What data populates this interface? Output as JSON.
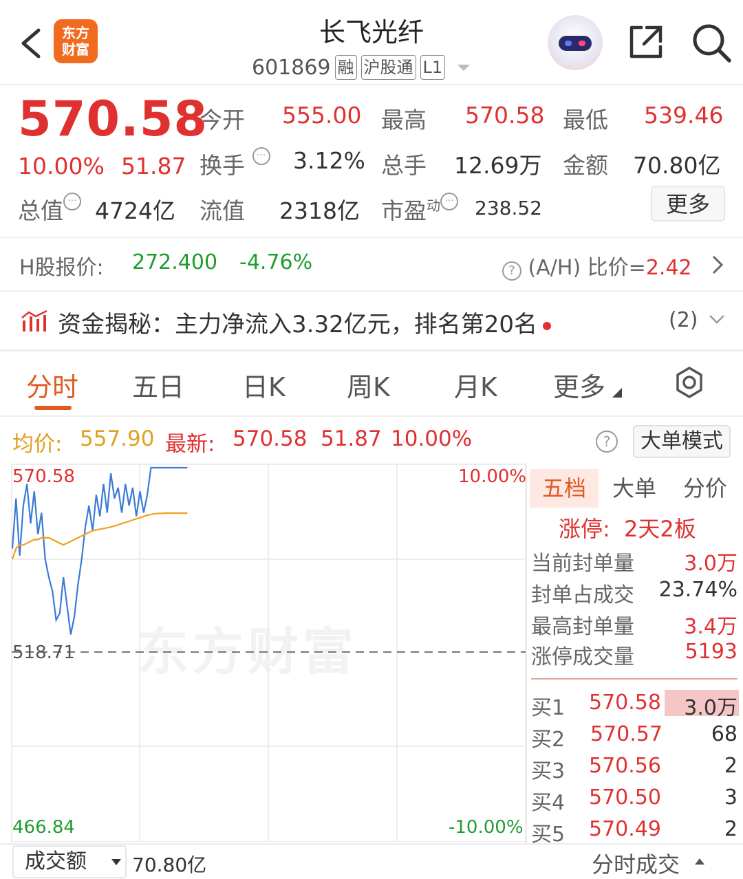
{
  "header": {
    "logo_text": "东方\n财富",
    "stock_name": "长飞光纤",
    "stock_code": "601869",
    "tags": [
      "融",
      "沪股通",
      "L1"
    ]
  },
  "quote": {
    "price": "570.58",
    "change_pct": "10.00%",
    "change_amt": "51.87",
    "fields": {
      "open_label": "今开",
      "open_value": "555.00",
      "high_label": "最高",
      "high_value": "570.58",
      "low_label": "最低",
      "low_value": "539.46",
      "turnover_label": "换手",
      "turnover_value": "3.12%",
      "volume_label": "总手",
      "volume_value": "12.69万",
      "amount_label": "金额",
      "amount_value": "70.80亿",
      "mktcap_label": "总值",
      "mktcap_value": "4724亿",
      "float_label": "流值",
      "float_value": "2318亿",
      "pe_label": "市盈",
      "pe_sup": "动",
      "pe_value": "238.52"
    },
    "more_button": "更多"
  },
  "h_share": {
    "label": "H股报价:",
    "price": "272.400",
    "change": "-4.76%",
    "ah_label": "(A/H) 比价=",
    "ah_value": "2.42"
  },
  "fund_flow": {
    "text": "资金揭秘：主力净流入3.32亿元，排名第20名",
    "count": "(2)"
  },
  "tabs": [
    "分时",
    "五日",
    "日K",
    "周K",
    "月K",
    "更多"
  ],
  "active_tab": "分时",
  "chart_header": {
    "avg_label": "均价:",
    "avg_value": "557.90",
    "latest_label": "最新:",
    "latest_price": "570.58",
    "latest_change": "51.87",
    "latest_pct": "10.00%",
    "big_order_button": "大单模式"
  },
  "chart_data": {
    "type": "line",
    "y_max_label": "570.58",
    "y_mid_label": "518.71",
    "y_min_label": "466.84",
    "pct_max_label": "10.00%",
    "pct_min_label": "-10.00%",
    "ylim": [
      466.84,
      570.58
    ],
    "prev_close": 518.71,
    "series": [
      {
        "values": [
          548,
          562,
          546,
          560,
          566,
          555,
          564,
          552,
          558,
          545,
          540,
          536,
          528,
          530,
          540,
          532,
          524,
          529,
          538,
          545,
          554,
          560,
          553,
          563,
          557,
          566,
          558,
          569,
          562,
          565,
          558,
          566,
          560,
          565,
          557,
          564,
          558,
          563,
          570.58,
          570.58,
          570.58,
          570.58,
          570.58,
          570.58,
          570.58,
          570.58,
          570.58,
          570.58,
          570.58
        ]
      },
      {
        "values": [
          545,
          548,
          549,
          549,
          549.5,
          550,
          550.5,
          550.5,
          551,
          551,
          551,
          550.5,
          550,
          549.5,
          549,
          549.5,
          550,
          550.5,
          551,
          551.5,
          552,
          552.5,
          553,
          553.2,
          553.4,
          553.6,
          553.8,
          554,
          554.3,
          554.6,
          555,
          555.3,
          555.6,
          556,
          556.3,
          556.6,
          557,
          557.3,
          557.5,
          557.7,
          557.8,
          557.85,
          557.88,
          557.9,
          557.9,
          557.9,
          557.9,
          557.9,
          557.9
        ]
      }
    ]
  },
  "watermark": "东方财富",
  "order_panel": {
    "tabs": [
      "五档",
      "大单",
      "分价"
    ],
    "limit_up_label": "涨停:",
    "limit_up_value": "2天2板",
    "stats": [
      {
        "label": "当前封单量",
        "value": "3.0万"
      },
      {
        "label": "封单占成交",
        "value": "23.74%"
      },
      {
        "label": "最高封单量",
        "value": "3.4万"
      },
      {
        "label": "涨停成交量",
        "value": "5193"
      }
    ],
    "bids": [
      {
        "label": "买1",
        "price": "570.58",
        "volume": "3.0万"
      },
      {
        "label": "买2",
        "price": "570.57",
        "volume": "68"
      },
      {
        "label": "买3",
        "price": "570.56",
        "volume": "2"
      },
      {
        "label": "买4",
        "price": "570.50",
        "volume": "3"
      },
      {
        "label": "买5",
        "price": "570.49",
        "volume": "2"
      }
    ]
  },
  "bottom": {
    "indicator_select": "成交额",
    "indicator_value": "70.80亿",
    "tick_trades": "分时成交"
  },
  "colors": {
    "up": "#e03131",
    "down": "#1f9d2e",
    "accent": "#e05a22",
    "price_line": "#3a7bd5",
    "avg_line": "#f0a020"
  }
}
